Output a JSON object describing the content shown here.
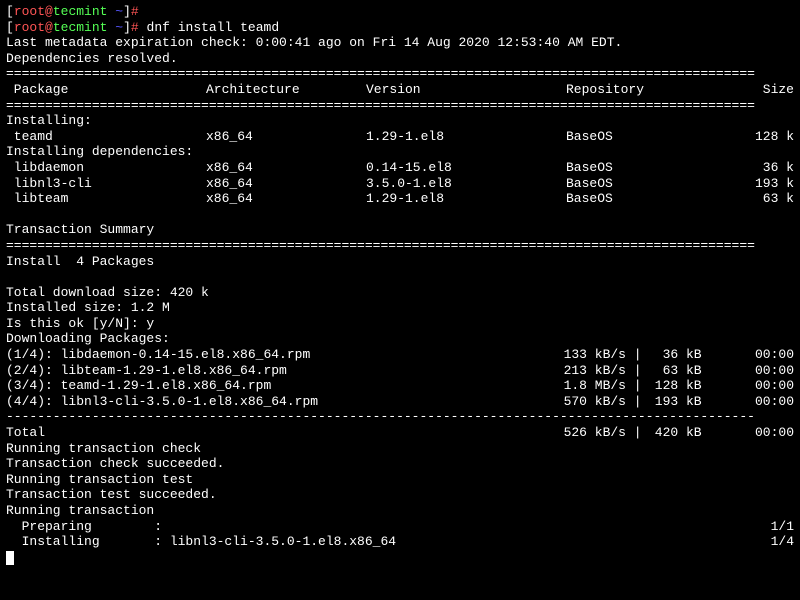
{
  "prompt": {
    "user": "root",
    "host": "tecmint",
    "path": "~",
    "bracket_open": "[",
    "bracket_close": "]",
    "at": "@",
    "hash": "#",
    "command": "dnf install teamd"
  },
  "metadata_check": "Last metadata expiration check: 0:00:41 ago on Fri 14 Aug 2020 12:53:40 AM EDT.",
  "deps_resolved": "Dependencies resolved.",
  "sep_line": "================================================================================================",
  "dash_line": "------------------------------------------------------------------------------------------------",
  "headers": {
    "package": " Package",
    "arch": "Architecture",
    "version": "Version",
    "repo": "Repository",
    "size": "Size"
  },
  "installing_label": "Installing:",
  "installing_deps_label": "Installing dependencies:",
  "packages": {
    "main": {
      "name": " teamd",
      "arch": "x86_64",
      "version": "1.29-1.el8",
      "repo": "BaseOS",
      "size": "128 k"
    },
    "deps": [
      {
        "name": " libdaemon",
        "arch": "x86_64",
        "version": "0.14-15.el8",
        "repo": "BaseOS",
        "size": "36 k"
      },
      {
        "name": " libnl3-cli",
        "arch": "x86_64",
        "version": "3.5.0-1.el8",
        "repo": "BaseOS",
        "size": "193 k"
      },
      {
        "name": " libteam",
        "arch": "x86_64",
        "version": "1.29-1.el8",
        "repo": "BaseOS",
        "size": "63 k"
      }
    ]
  },
  "transaction_summary": "Transaction Summary",
  "install_count": "Install  4 Packages",
  "download_size": "Total download size: 420 k",
  "installed_size": "Installed size: 1.2 M",
  "confirm_prompt": "Is this ok [y/N]: y",
  "downloading_label": "Downloading Packages:",
  "downloads": [
    {
      "file": "(1/4): libdaemon-0.14-15.el8.x86_64.rpm",
      "speed": "133 kB/s",
      "size": " 36 kB",
      "time": "00:00"
    },
    {
      "file": "(2/4): libteam-1.29-1.el8.x86_64.rpm",
      "speed": "213 kB/s",
      "size": " 63 kB",
      "time": "00:00"
    },
    {
      "file": "(3/4): teamd-1.29-1.el8.x86_64.rpm",
      "speed": "1.8 MB/s",
      "size": "128 kB",
      "time": "00:00"
    },
    {
      "file": "(4/4): libnl3-cli-3.5.0-1.el8.x86_64.rpm",
      "speed": "570 kB/s",
      "size": "193 kB",
      "time": "00:00"
    }
  ],
  "total_line": {
    "label": "Total",
    "speed": "526 kB/s",
    "size": "420 kB",
    "time": "00:00"
  },
  "transaction_steps": {
    "check": "Running transaction check",
    "check_ok": "Transaction check succeeded.",
    "test": "Running transaction test",
    "test_ok": "Transaction test succeeded.",
    "running": "Running transaction"
  },
  "progress": {
    "preparing": {
      "label": "  Preparing        :",
      "count": "1/1"
    },
    "installing": {
      "label": "  Installing       : libnl3-cli-3.5.0-1.el8.x86_64",
      "count": "1/4"
    }
  }
}
